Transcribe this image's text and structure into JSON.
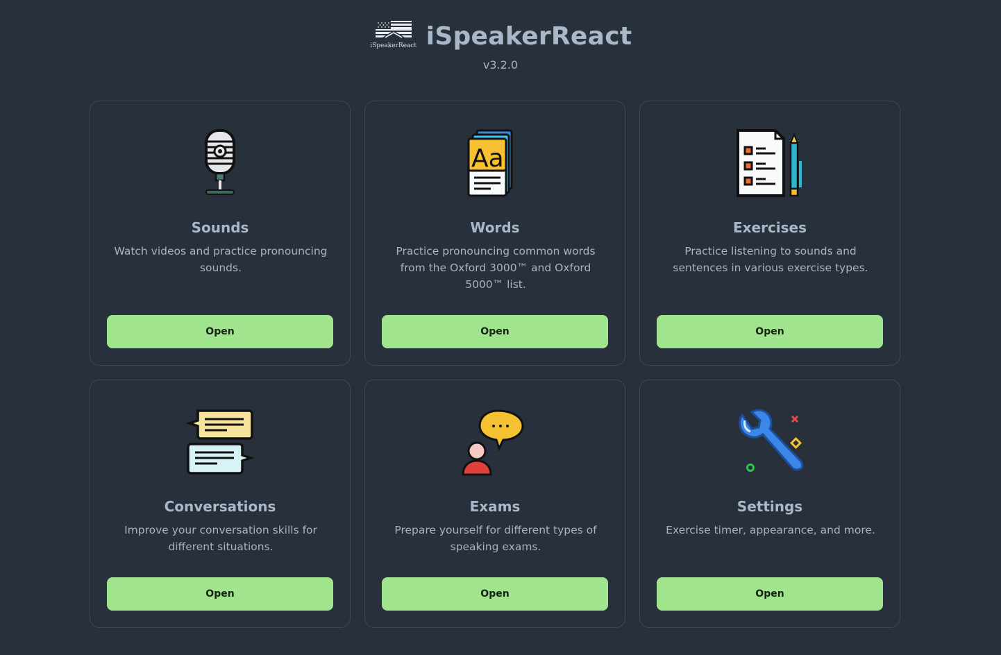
{
  "app": {
    "title": "iSpeakerReact",
    "logo_caption": "iSpeakerReact",
    "version": "v3.2.0"
  },
  "cards": [
    {
      "title": "Sounds",
      "description": "Watch videos and practice pronouncing sounds.",
      "button_label": "Open",
      "icon": "microphone-icon"
    },
    {
      "title": "Words",
      "description": "Practice pronouncing common words from the Oxford 3000™ and Oxford 5000™ list.",
      "button_label": "Open",
      "icon": "dictionary-cards-icon"
    },
    {
      "title": "Exercises",
      "description": "Practice listening to sounds and sentences in various exercise types.",
      "button_label": "Open",
      "icon": "checklist-icon"
    },
    {
      "title": "Conversations",
      "description": "Improve your conversation skills for different situations.",
      "button_label": "Open",
      "icon": "chat-bubbles-icon"
    },
    {
      "title": "Exams",
      "description": "Prepare yourself for different types of speaking exams.",
      "button_label": "Open",
      "icon": "speaking-person-icon"
    },
    {
      "title": "Settings",
      "description": "Exercise timer, appearance, and more.",
      "button_label": "Open",
      "icon": "wrench-icon"
    }
  ],
  "colors": {
    "background": "#28303b",
    "card_border": "#3d4755",
    "button": "#a0e58e",
    "title_text": "#a9b8c9"
  }
}
